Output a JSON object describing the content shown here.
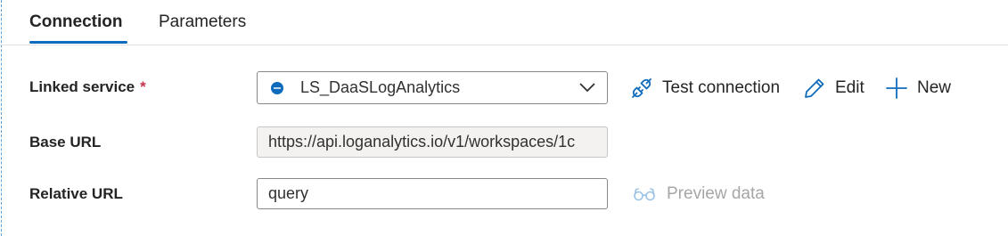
{
  "tabs": [
    {
      "label": "Connection",
      "selected": true
    },
    {
      "label": "Parameters",
      "selected": false
    }
  ],
  "form": {
    "linked_service": {
      "label": "Linked service",
      "required_marker": "*",
      "value": "LS_DaaSLogAnalytics"
    },
    "base_url": {
      "label": "Base URL",
      "value": "https://api.loganalytics.io/v1/workspaces/1c"
    },
    "relative_url": {
      "label": "Relative URL",
      "value": "query"
    }
  },
  "actions": {
    "test_connection": "Test connection",
    "edit": "Edit",
    "new": "New",
    "preview_data": "Preview data"
  },
  "colors": {
    "accent": "#0f6cbd",
    "required": "#c4314b",
    "disabled_text": "#a6a6a6",
    "disabled_field_bg": "#f3f2f1"
  },
  "icons": {
    "service": "log-analytics-service-icon",
    "dropdown": "chevron-down-icon",
    "test": "plug-connection-icon",
    "edit": "pencil-icon",
    "new": "plus-icon",
    "preview": "glasses-icon"
  }
}
